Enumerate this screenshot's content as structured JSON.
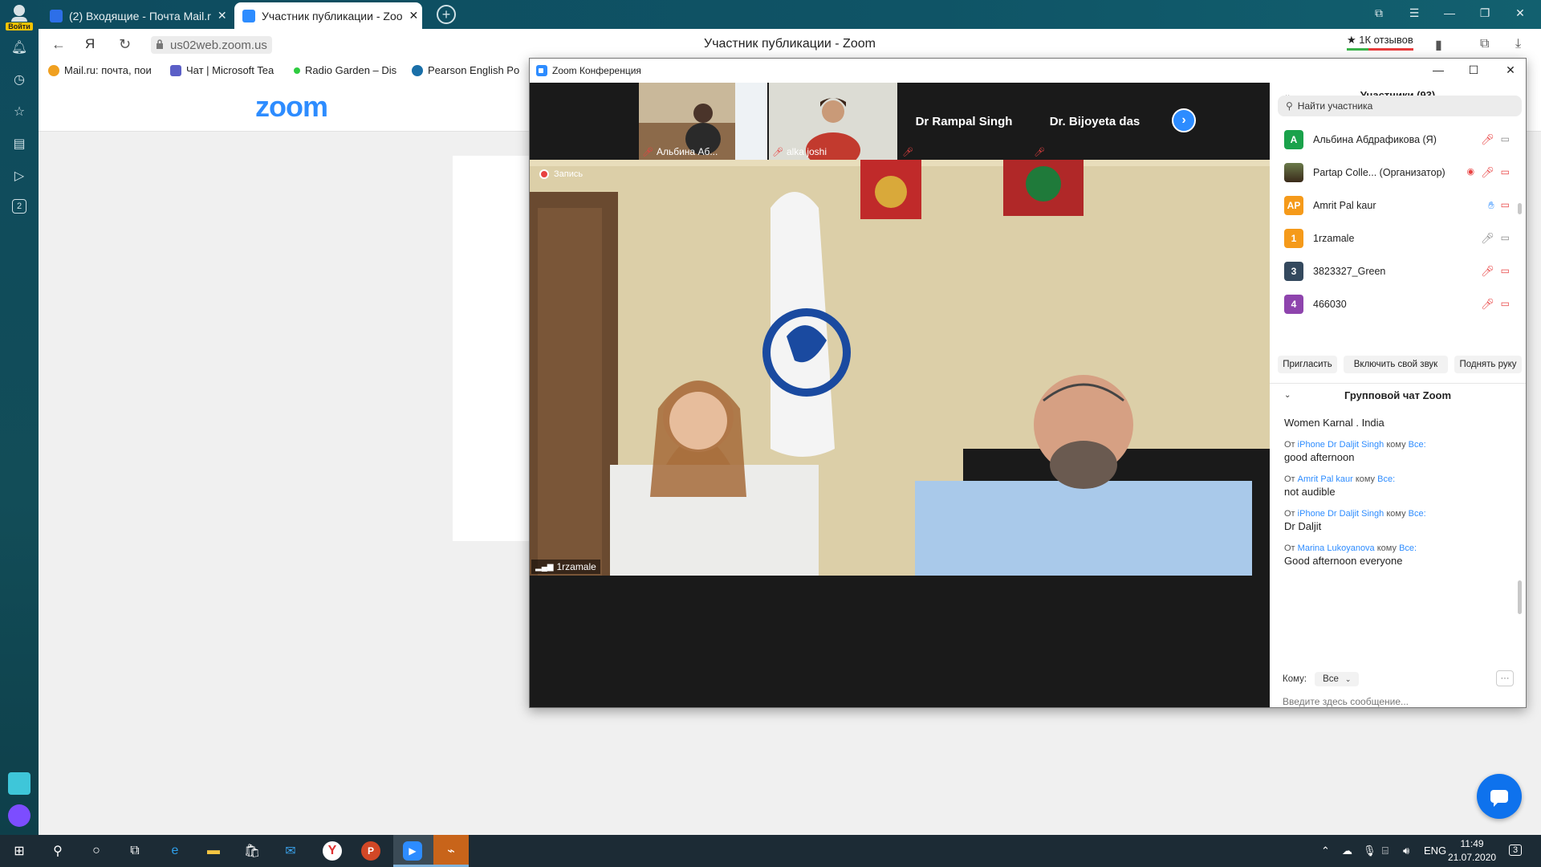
{
  "browser": {
    "tabs": [
      {
        "label": "(2) Входящие - Почта Mail.r",
        "active": false
      },
      {
        "label": "Участник публикации - Zoo",
        "active": true
      }
    ],
    "rail_user_badge": "Войти",
    "url": "us02web.zoom.us",
    "page_title": "Участник публикации - Zoom",
    "reviews": "★ 1К отзывов",
    "bookmarks": [
      {
        "label": "Mail.ru: почта, пои"
      },
      {
        "label": "Чат | Microsoft Tea"
      },
      {
        "label": "Radio Garden – Dis"
      },
      {
        "label": "Pearson English Po"
      }
    ],
    "rail_badge_number": "2"
  },
  "zoom_page": {
    "logo": "zoom"
  },
  "zoom_window": {
    "title": "Zoom Конференция",
    "thumbnails": [
      {
        "name": "Альбина Аб..."
      },
      {
        "name": "alka joshi"
      },
      {
        "name": "Dr Rampal Singh"
      },
      {
        "name": "Dr. Bijoyeta das"
      }
    ],
    "recording_label": "Запись",
    "active_speaker": "1rzamale",
    "participants_header": "Участники (93)",
    "search_placeholder": "Найти участника",
    "participants": [
      {
        "initials": "A",
        "name": "Альбина Абдрафикова (Я)",
        "color": "#1aa24b"
      },
      {
        "initials": "",
        "name": "Partap Colle... (Организатор)",
        "color": "#4a5a3a"
      },
      {
        "initials": "AP",
        "name": "Amrit Pal kaur",
        "color": "#f59a1a"
      },
      {
        "initials": "1",
        "name": "1rzamale",
        "color": "#f59a1a"
      },
      {
        "initials": "3",
        "name": "3823327_Green",
        "color": "#34495e"
      },
      {
        "initials": "4",
        "name": "466030",
        "color": "#8e44ad"
      }
    ],
    "buttons": {
      "invite": "Пригласить",
      "unmute": "Включить свой звук",
      "raise_hand": "Поднять руку"
    },
    "chat_header": "Групповой чат Zoom",
    "chat_messages": [
      {
        "from_prefix": "",
        "from": "",
        "to_word": "",
        "to": "",
        "text": "Women Karnal . India"
      },
      {
        "from_prefix": "От",
        "from": "iPhone Dr Daljit Singh",
        "to_word": "кому",
        "to": "Все:",
        "text": "good afternoon"
      },
      {
        "from_prefix": "От",
        "from": "Amrit Pal kaur",
        "to_word": "кому",
        "to": "Все:",
        "text": "not audible"
      },
      {
        "from_prefix": "От",
        "from": "iPhone Dr Daljit Singh",
        "to_word": "кому",
        "to": "Все:",
        "text": "Dr Daljit"
      },
      {
        "from_prefix": "От",
        "from": "Marina Lukoyanova",
        "to_word": "кому",
        "to": "Все:",
        "text": "Good afternoon everyone"
      }
    ],
    "to_label": "Кому:",
    "to_value": "Все",
    "more_label": "···",
    "chat_input_placeholder": "Введите здесь сообщение..."
  },
  "taskbar": {
    "lang": "ENG",
    "time": "11:49",
    "date": "21.07.2020",
    "notifications": "3"
  }
}
